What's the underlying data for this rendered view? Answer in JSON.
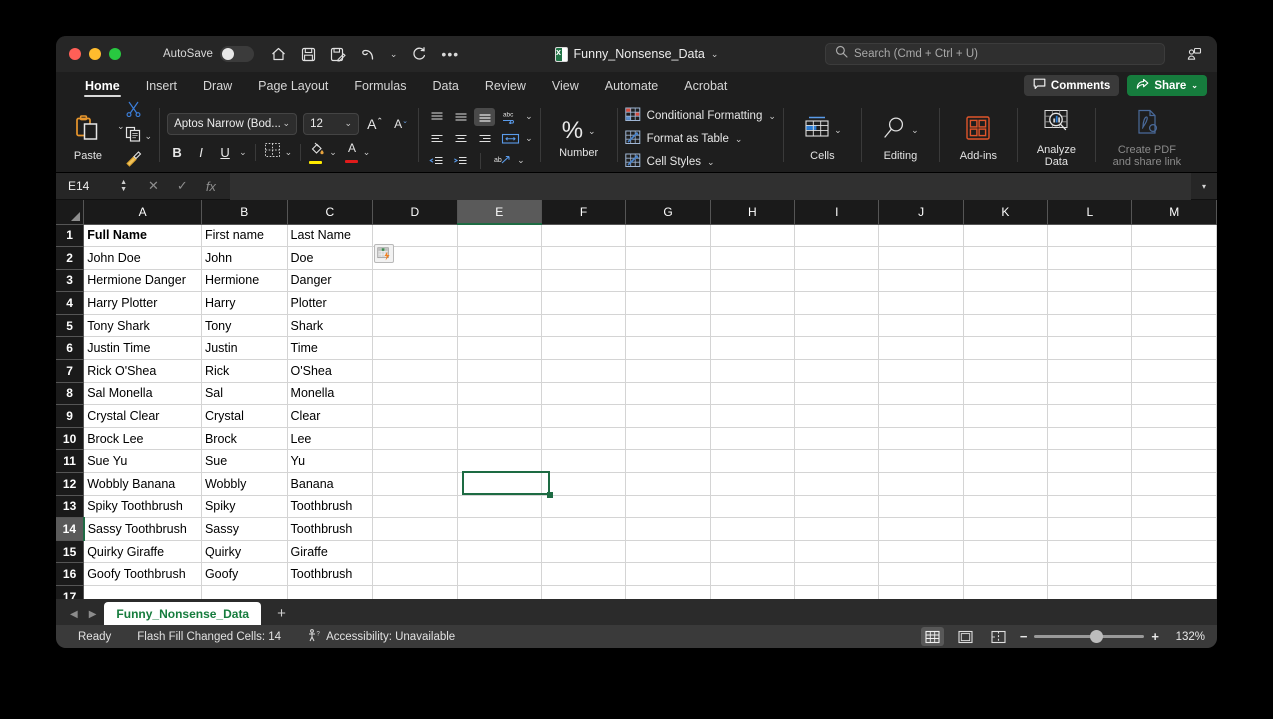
{
  "titlebar": {
    "autosave_label": "AutoSave",
    "autosave_state": "off",
    "document_name": "Funny_Nonsense_Data",
    "title_caret": "⌄",
    "quick_access": [
      "home-icon",
      "save-icon",
      "save-as-icon",
      "undo-icon",
      "redo-icon",
      "more-icon"
    ],
    "search_placeholder": "Search (Cmd + Ctrl + U)"
  },
  "tabs": [
    {
      "label": "Home",
      "active": true
    },
    {
      "label": "Insert",
      "active": false
    },
    {
      "label": "Draw",
      "active": false
    },
    {
      "label": "Page Layout",
      "active": false
    },
    {
      "label": "Formulas",
      "active": false
    },
    {
      "label": "Data",
      "active": false
    },
    {
      "label": "Review",
      "active": false
    },
    {
      "label": "View",
      "active": false
    },
    {
      "label": "Automate",
      "active": false
    },
    {
      "label": "Acrobat",
      "active": false
    }
  ],
  "tabbar_right": {
    "comments_label": "Comments",
    "share_label": "Share",
    "share_caret": "⌄"
  },
  "ribbon": {
    "paste_label": "Paste",
    "font_name": "Aptos Narrow (Bod...",
    "font_size": "12",
    "grow_font": "A",
    "shrink_font": "A",
    "bold": "B",
    "italic": "I",
    "underline": "U",
    "number_label": "Number",
    "number_symbol": "%",
    "conditional_formatting": "Conditional Formatting",
    "format_as_table": "Format as Table",
    "cell_styles": "Cell Styles",
    "cells_label": "Cells",
    "editing_label": "Editing",
    "addins_label": "Add-ins",
    "analyze_label_1": "Analyze",
    "analyze_label_2": "Data",
    "createpdf_label_1": "Create PDF",
    "createpdf_label_2": "and share link",
    "caret": "⌄"
  },
  "formula_bar": {
    "name_box": "E14",
    "cancel_icon": "✕",
    "confirm_icon": "✓",
    "fx_icon": "fx",
    "formula_value": "",
    "expand_caret": "▾"
  },
  "grid": {
    "columns": [
      "A",
      "B",
      "C",
      "D",
      "E",
      "F",
      "G",
      "H",
      "I",
      "J",
      "K",
      "L",
      "M"
    ],
    "selected_column": "E",
    "selected_row": 14,
    "selected_cell": "E14",
    "rows": [
      {
        "num": "1",
        "cells": [
          "Full Name",
          "First name",
          "Last Name"
        ],
        "bold": true
      },
      {
        "num": "2",
        "cells": [
          "John Doe",
          "John",
          "Doe"
        ],
        "bold": false
      },
      {
        "num": "3",
        "cells": [
          "Hermione Danger",
          "Hermione",
          "Danger"
        ],
        "bold": false
      },
      {
        "num": "4",
        "cells": [
          "Harry Plotter",
          "Harry",
          "Plotter"
        ],
        "bold": false
      },
      {
        "num": "5",
        "cells": [
          "Tony Shark",
          "Tony",
          "Shark"
        ],
        "bold": false
      },
      {
        "num": "6",
        "cells": [
          "Justin Time",
          "Justin",
          "Time"
        ],
        "bold": false
      },
      {
        "num": "7",
        "cells": [
          "Rick O'Shea",
          "Rick",
          "O'Shea"
        ],
        "bold": false
      },
      {
        "num": "8",
        "cells": [
          "Sal Monella",
          "Sal",
          "Monella"
        ],
        "bold": false
      },
      {
        "num": "9",
        "cells": [
          "Crystal Clear",
          "Crystal",
          "Clear"
        ],
        "bold": false
      },
      {
        "num": "10",
        "cells": [
          "Brock Lee",
          "Brock",
          "Lee"
        ],
        "bold": false
      },
      {
        "num": "11",
        "cells": [
          "Sue Yu",
          "Sue",
          "Yu"
        ],
        "bold": false
      },
      {
        "num": "12",
        "cells": [
          "Wobbly Banana",
          "Wobbly",
          "Banana"
        ],
        "bold": false
      },
      {
        "num": "13",
        "cells": [
          "Spiky Toothbrush",
          "Spiky",
          "Toothbrush"
        ],
        "bold": false
      },
      {
        "num": "14",
        "cells": [
          "Sassy Toothbrush",
          "Sassy",
          "Toothbrush"
        ],
        "bold": false
      },
      {
        "num": "15",
        "cells": [
          "Quirky Giraffe",
          "Quirky",
          "Giraffe"
        ],
        "bold": false
      },
      {
        "num": "16",
        "cells": [
          "Goofy Toothbrush",
          "Goofy",
          "Toothbrush"
        ],
        "bold": false
      },
      {
        "num": "17",
        "cells": [
          "",
          "",
          ""
        ],
        "bold": false
      }
    ],
    "flash_fill_tag": "flash-fill-options-icon"
  },
  "sheetbar": {
    "prev_icon": "◀",
    "next_icon": "▶",
    "sheet_name": "Funny_Nonsense_Data",
    "add_sheet": "+"
  },
  "statusbar": {
    "mode": "Ready",
    "flash_fill": "Flash Fill Changed Cells: 14",
    "accessibility": "Accessibility: Unavailable",
    "zoom_out": "−",
    "zoom_in": "+",
    "zoom_level": "132%",
    "views": [
      "normal-view-icon",
      "page-layout-view-icon",
      "page-break-view-icon"
    ]
  },
  "colors": {
    "excel_green": "#167c3d",
    "selection_green": "#1d6b43",
    "window_bg": "#1e1e1e",
    "grid_bg": "#ffffff",
    "accent_orange": "#e8790a"
  }
}
